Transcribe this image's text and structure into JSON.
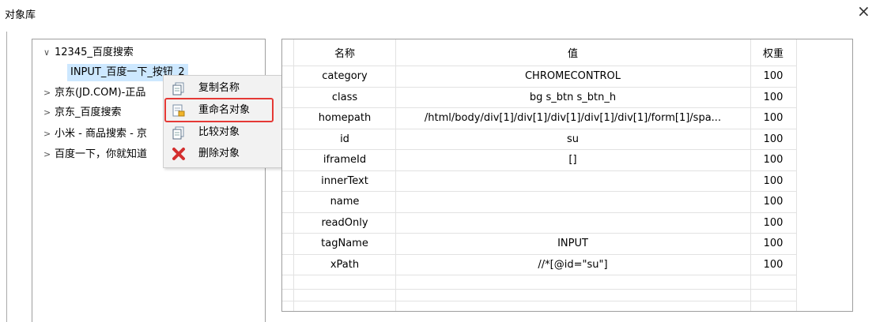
{
  "window": {
    "title": "对象库",
    "close": "×"
  },
  "tree": [
    {
      "label": "12345_百度搜索",
      "expanded": true
    },
    {
      "label": "京东(JD.COM)-正品",
      "expanded": false
    },
    {
      "label": "京东_百度搜索",
      "expanded": false
    },
    {
      "label": "小米 - 商品搜索 - 京",
      "expanded": false
    },
    {
      "label": "百度一下，你就知道",
      "expanded": false
    }
  ],
  "tree_child": {
    "label": "INPUT_百度一下_按钮_2"
  },
  "context_menu": [
    {
      "label": "复制名称",
      "icon": "copy-name-icon"
    },
    {
      "label": "重命名对象",
      "icon": "rename-icon"
    },
    {
      "label": "比较对象",
      "icon": "compare-icon"
    },
    {
      "label": "删除对象",
      "icon": "delete-icon"
    }
  ],
  "table": {
    "headers": [
      "名称",
      "值",
      "权重"
    ],
    "rows": [
      [
        "category",
        "CHROMECONTROL",
        "100"
      ],
      [
        "class",
        "bg s_btn s_btn_h",
        "100"
      ],
      [
        "homepath",
        "/html/body/div[1]/div[1]/div[1]/div[1]/div[1]/form[1]/spa...",
        "100"
      ],
      [
        "id",
        "su",
        "100"
      ],
      [
        "iframeId",
        "[]",
        "100"
      ],
      [
        "innerText",
        "",
        "100"
      ],
      [
        "name",
        "",
        "100"
      ],
      [
        "readOnly",
        "",
        "100"
      ],
      [
        "tagName",
        "INPUT",
        "100"
      ],
      [
        "xPath",
        "//*[@id=\"su\"]",
        "100"
      ]
    ]
  },
  "colors": {
    "selection": "#cde8ff",
    "highlight_border": "#e53935",
    "menu_bg": "#f2f2f2",
    "delete_icon": "#d32f2f"
  }
}
